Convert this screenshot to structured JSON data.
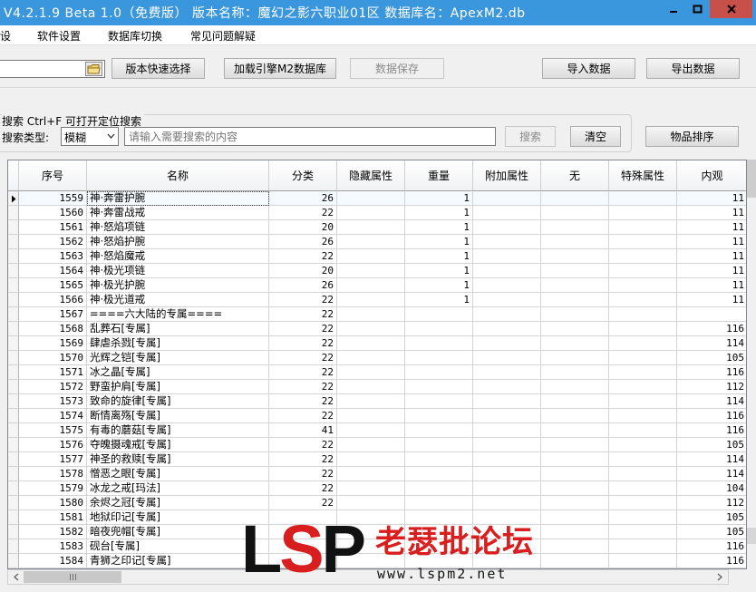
{
  "window": {
    "title": "V4.2.1.9   Beta 1.0（免费版）   版本名称：魔幻之影六职业01区     数据库名：ApexM2.db"
  },
  "menu": {
    "items": [
      {
        "label": "设"
      },
      {
        "label": "软件设置"
      },
      {
        "label": "数据库切换"
      },
      {
        "label": "常见问题解疑"
      }
    ]
  },
  "toolbar": {
    "path_value": "",
    "version_select_label": "版本快速选择",
    "load_db_label": "加载引擎M2数据库",
    "save_label": "数据保存",
    "import_label": "导入数据",
    "export_label": "导出数据"
  },
  "search": {
    "hint": "搜索  Ctrl+F 可打开定位搜索",
    "type_label": "搜索类型:",
    "type_value": "模糊",
    "placeholder": "请输入需要搜索的内容",
    "search_label": "搜索",
    "clear_label": "清空",
    "sort_label": "物品排序"
  },
  "grid": {
    "columns": [
      "序号",
      "名称",
      "分类",
      "隐藏属性",
      "重量",
      "附加属性",
      "无",
      "特殊属性",
      "内观"
    ],
    "rows": [
      {
        "id": "1559",
        "name": "神·奔雷护腕",
        "cat": "26",
        "hidden": "",
        "weight": "1",
        "extra": "",
        "none": "",
        "special": "",
        "look": "11"
      },
      {
        "id": "1560",
        "name": "神·奔雷战戒",
        "cat": "22",
        "hidden": "",
        "weight": "1",
        "extra": "",
        "none": "",
        "special": "",
        "look": "11"
      },
      {
        "id": "1561",
        "name": "神·怒焰项链",
        "cat": "20",
        "hidden": "",
        "weight": "1",
        "extra": "",
        "none": "",
        "special": "",
        "look": "11"
      },
      {
        "id": "1562",
        "name": "神·怒焰护腕",
        "cat": "26",
        "hidden": "",
        "weight": "1",
        "extra": "",
        "none": "",
        "special": "",
        "look": "11"
      },
      {
        "id": "1563",
        "name": "神·怒焰魔戒",
        "cat": "22",
        "hidden": "",
        "weight": "1",
        "extra": "",
        "none": "",
        "special": "",
        "look": "11"
      },
      {
        "id": "1564",
        "name": "神·极光项链",
        "cat": "20",
        "hidden": "",
        "weight": "1",
        "extra": "",
        "none": "",
        "special": "",
        "look": "11"
      },
      {
        "id": "1565",
        "name": "神·极光护腕",
        "cat": "26",
        "hidden": "",
        "weight": "1",
        "extra": "",
        "none": "",
        "special": "",
        "look": "11"
      },
      {
        "id": "1566",
        "name": "神·极光道戒",
        "cat": "22",
        "hidden": "",
        "weight": "1",
        "extra": "",
        "none": "",
        "special": "",
        "look": "11"
      },
      {
        "id": "1567",
        "name": "====六大陆的专属====",
        "cat": "22",
        "hidden": "",
        "weight": "",
        "extra": "",
        "none": "",
        "special": "",
        "look": ""
      },
      {
        "id": "1568",
        "name": "乱葬石[专属]",
        "cat": "22",
        "hidden": "",
        "weight": "",
        "extra": "",
        "none": "",
        "special": "",
        "look": "116"
      },
      {
        "id": "1569",
        "name": "肆虐杀戮[专属]",
        "cat": "22",
        "hidden": "",
        "weight": "",
        "extra": "",
        "none": "",
        "special": "",
        "look": "114"
      },
      {
        "id": "1570",
        "name": "光辉之铠[专属]",
        "cat": "22",
        "hidden": "",
        "weight": "",
        "extra": "",
        "none": "",
        "special": "",
        "look": "105"
      },
      {
        "id": "1571",
        "name": "冰之晶[专属]",
        "cat": "22",
        "hidden": "",
        "weight": "",
        "extra": "",
        "none": "",
        "special": "",
        "look": "116"
      },
      {
        "id": "1572",
        "name": "野蛮护肩[专属]",
        "cat": "22",
        "hidden": "",
        "weight": "",
        "extra": "",
        "none": "",
        "special": "",
        "look": "112"
      },
      {
        "id": "1573",
        "name": "致命的旋律[专属]",
        "cat": "22",
        "hidden": "",
        "weight": "",
        "extra": "",
        "none": "",
        "special": "",
        "look": "114"
      },
      {
        "id": "1574",
        "name": "断情离殇[专属]",
        "cat": "22",
        "hidden": "",
        "weight": "",
        "extra": "",
        "none": "",
        "special": "",
        "look": "116"
      },
      {
        "id": "1575",
        "name": "有毒的蘑菇[专属]",
        "cat": "41",
        "hidden": "",
        "weight": "",
        "extra": "",
        "none": "",
        "special": "",
        "look": "116"
      },
      {
        "id": "1576",
        "name": "夺魄摄魂戒[专属]",
        "cat": "22",
        "hidden": "",
        "weight": "",
        "extra": "",
        "none": "",
        "special": "",
        "look": "105"
      },
      {
        "id": "1577",
        "name": "神圣的救赎[专属]",
        "cat": "22",
        "hidden": "",
        "weight": "",
        "extra": "",
        "none": "",
        "special": "",
        "look": "114"
      },
      {
        "id": "1578",
        "name": "憎恶之眼[专属]",
        "cat": "22",
        "hidden": "",
        "weight": "",
        "extra": "",
        "none": "",
        "special": "",
        "look": "114"
      },
      {
        "id": "1579",
        "name": "冰龙之戒[玛法]",
        "cat": "22",
        "hidden": "",
        "weight": "",
        "extra": "",
        "none": "",
        "special": "",
        "look": "104"
      },
      {
        "id": "1580",
        "name": "余烬之冠[专属]",
        "cat": "22",
        "hidden": "",
        "weight": "",
        "extra": "",
        "none": "",
        "special": "",
        "look": "112"
      },
      {
        "id": "1581",
        "name": "地狱印记[专属]",
        "cat": "",
        "hidden": "",
        "weight": "",
        "extra": "",
        "none": "",
        "special": "",
        "look": "105"
      },
      {
        "id": "1582",
        "name": "暗夜兜帽[专属]",
        "cat": "",
        "hidden": "",
        "weight": "",
        "extra": "",
        "none": "",
        "special": "",
        "look": "105"
      },
      {
        "id": "1583",
        "name": "砚台[专属]",
        "cat": "",
        "hidden": "",
        "weight": "",
        "extra": "",
        "none": "",
        "special": "",
        "look": "116"
      },
      {
        "id": "1584",
        "name": "青狮之印记[专属]",
        "cat": "",
        "hidden": "",
        "weight": "",
        "extra": "",
        "none": "",
        "special": "",
        "look": "116"
      }
    ]
  },
  "watermark": {
    "logo_l": "L",
    "logo_s": "S",
    "logo_p": "P",
    "name": "老瑟批论坛",
    "url": "www.lspm2.net"
  },
  "colors": {
    "titlebar": "#3a96dd",
    "close_button": "#c7504b",
    "watermark_red": "#d81e1e"
  }
}
